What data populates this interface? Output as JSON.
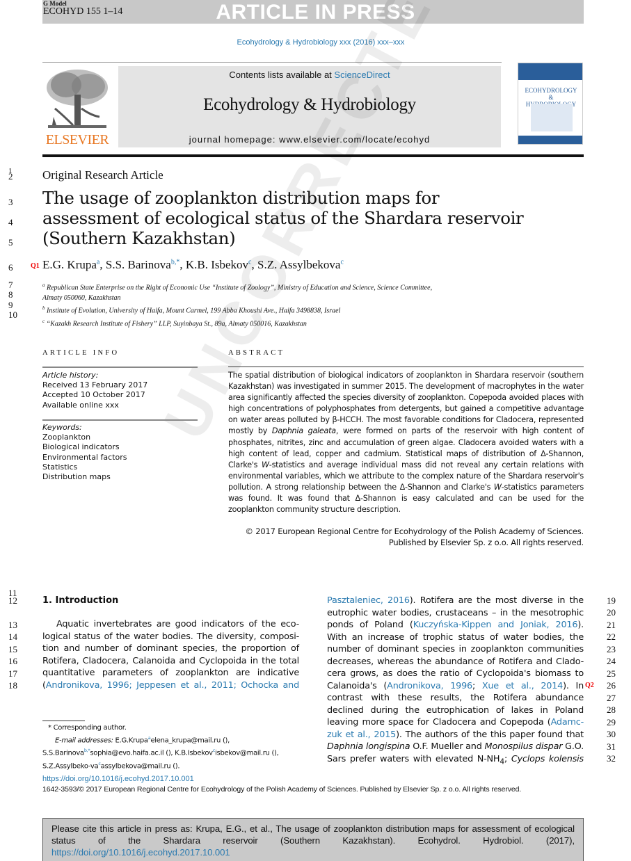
{
  "banner": {
    "model": "G Model",
    "code": "ECOHYD 155 1–14",
    "status": "ARTICLE IN PRESS"
  },
  "journal_line": "Ecohydrology & Hydrobiology xxx (2016) xxx–xxx",
  "masthead": {
    "publisher": "ELSEVIER",
    "contents_prefix": "Contents lists available at ",
    "contents_link": "ScienceDirect",
    "journal_name": "Ecohydrology & Hydrobiology",
    "homepage": "journal homepage: www.elsevier.com/locate/ecohyd",
    "cover_title_1": "ECOHYDROLOGY",
    "cover_title_2": "&",
    "cover_title_3": "HYDROBIOLOGY"
  },
  "article": {
    "type": "Original Research Article",
    "title": "The usage of zooplankton distribution maps for assessment of ecological status of the Shardara reservoir (Southern Kazakhstan)",
    "query_marks": [
      "Q1",
      "Q2"
    ],
    "authors": [
      {
        "name": "E.G. Krupa",
        "sup": "a"
      },
      {
        "name": "S.S. Barinova",
        "sup": "b,*"
      },
      {
        "name": "K.B. Isbekov",
        "sup": "c"
      },
      {
        "name": "S.Z. Assylbekova",
        "sup": "c"
      }
    ],
    "affiliations": [
      {
        "sup": "a",
        "line1": "Republican State Enterprise on the Right of Economic Use “Institute of Zoology”, Ministry of Education and Science, Science Committee,",
        "line2": "Almaty 050060, Kazakhstan"
      },
      {
        "sup": "b",
        "line1": "Institute of Evolution, University of Haifa, Mount Carmel, 199 Abba Khoushi Ave., Haifa 3498838, Israel"
      },
      {
        "sup": "c",
        "line1": "“Kazakh Research Institute of Fishery” LLP, Suyinbaya St., 89a, Almaty 050016, Kazakhstan"
      }
    ]
  },
  "article_info": {
    "heading": "ARTICLE INFO",
    "history_label": "Article history:",
    "received": "Received 13 February 2017",
    "accepted": "Accepted 10 October 2017",
    "online": "Available online xxx",
    "keywords_label": "Keywords:",
    "keywords": [
      "Zooplankton",
      "Biological indicators",
      "Environmental factors",
      "Statistics",
      "Distribution maps"
    ]
  },
  "abstract": {
    "heading": "ABSTRACT",
    "part1": "The spatial distribution of biological indicators of zooplankton in Shardara reservoir (southern Kazakhstan) was investigated in summer 2015. The development of macrophytes in the water area significantly affected the species diversity of zooplankton. Copepoda avoided places with high concentrations of polyphosphates from detergents, but gained a competitive advantage on water areas polluted by β-HCCH. The most favorable conditions for Cladocera, represented mostly by ",
    "italic1": "Daphnia galeata",
    "part2": ", were formed on parts of the reservoir with high content of phosphates, nitrites, zinc and accumulation of green algae. Cladocera avoided waters with a high content of lead, copper and cadmium. Statistical maps of distribution of Δ-Shannon, Clarke's ",
    "italic2": "W",
    "part3": "-statistics and average individual mass did not reveal any certain relations with environmental variables, which we attribute to the complex nature of the Shardara reservoir's pollution. A strong relationship between the Δ-Shannon and Clarke's ",
    "italic3": "W",
    "part4": "-statistics parameters was found. It was found that Δ-Shannon is easy calculated and can be used for the zooplankton community structure description.",
    "copyright_1": "© 2017 European Regional Centre for Ecohydrology of the Polish Academy of Sciences.",
    "copyright_2": "Published by Elsevier Sp. z o.o. All rights reserved."
  },
  "introduction": {
    "heading": "1.  Introduction",
    "left_lines": [
      {
        "n": "13",
        "text": "Aquatic invertebrates are good indicators of the eco-"
      },
      {
        "n": "14",
        "text": "logical status of the water bodies. The diversity, composi-"
      },
      {
        "n": "15",
        "text": "tion and number of dominant species, the proportion of"
      },
      {
        "n": "16",
        "text": "Rotifera, Cladocera, Calanoida and Cyclopoida in the total"
      },
      {
        "n": "17",
        "text": "quantitative parameters of zooplankton are indicative"
      }
    ],
    "line18_pre": "(",
    "line18_link": "Andronikova, 1996; Jeppesen et al., 2011; Ochocka and",
    "line19_link": "Pasztaleniec, 2016",
    "line19_rest": "). Rotifera are the most diverse in the",
    "line20": "eutrophic water bodies, crustaceans – in the mesotrophic",
    "line21_pre": "ponds of Poland (",
    "line21_link": "Kuczyńska-Kippen and Joniak, 2016",
    "line21_post": ").",
    "line22": "With an increase of trophic status of water bodies, the",
    "line23": "number of dominant species in zooplankton communities",
    "line24": "decreases, whereas the abundance of Rotifera and Clado-",
    "line25": "cera grows, as does the ratio of Cyclopoida's biomass to",
    "line26_pre": "Calanoida's (",
    "line26_link1": "Andronikova, 1996",
    "line26_mid": "; ",
    "line26_link2": "Xue et al., 2014",
    "line26_post": "). In",
    "line27": "contrast with these results, the Rotifera abundance",
    "line28": "declined during the eutrophication of lakes in Poland",
    "line29_pre": "leaving more space for Cladocera and Copepoda (",
    "line29_link": "Adamc-",
    "line30_link": "zuk et al., 2015",
    "line30_post": "). The authors of the this paper found that",
    "line31_i1": "Daphnia longispina",
    "line31_m": " O.F. Mueller and ",
    "line31_i2": "Monospilus dispar",
    "line31_post": " G.O.",
    "line32_pre": "Sars prefer waters with elevated N-NH",
    "line32_sub": "4",
    "line32_mid": "; ",
    "line32_i": "Cyclops kolensis"
  },
  "line_numbers": {
    "left": [
      "1",
      "2",
      "3",
      "4",
      "5",
      "6",
      "7",
      "8",
      "9",
      "10",
      "11",
      "12",
      "13",
      "14",
      "15",
      "16",
      "17",
      "18"
    ],
    "right": [
      "19",
      "20",
      "21",
      "22",
      "23",
      "24",
      "25",
      "26",
      "27",
      "28",
      "29",
      "30",
      "31",
      "32"
    ]
  },
  "footnote": {
    "corresponding": "* Corresponding author.",
    "email_label": "E-mail addresses:",
    "emails": " E.G.Krupa",
    "e1": "elena_krupa@mail.ru (), S.S.Barinova",
    "e2": "sophia@evo.haifa.ac.il (), K.B.Isbekov",
    "e3": "isbekov@mail.ru (), S.Z.Assylbeko-va",
    "e4": "assylbekova@mail.ru ()."
  },
  "doi": "https://doi.org/10.1016/j.ecohyd.2017.10.001",
  "issn_line": "1642-3593/© 2017 European Regional Centre for Ecohydrology of the Polish Academy of Sciences. Published by Elsevier Sp. z o.o. All rights reserved.",
  "cite_box": {
    "text": "Please cite this article in press as: Krupa, E.G., et al., The usage of zooplankton distribution maps for assessment of ecological status of the Shardara reservoir (Southern Kazakhstan). Ecohydrol. Hydrobiol. (2017), ",
    "link": "https://doi.org/10.1016/j.ecohyd.2017.10.001"
  },
  "watermark": "UNCORRECTED PROOF"
}
